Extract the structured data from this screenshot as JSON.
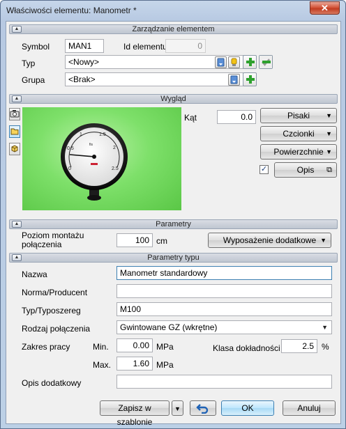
{
  "window": {
    "title": "Właściwości elementu: Manometr *",
    "close_glyph": "✕"
  },
  "sections": {
    "management": "Zarządzanie elementem",
    "appearance": "Wygląd",
    "parameters": "Parametry",
    "type_parameters": "Parametry typu"
  },
  "management": {
    "symbol_label": "Symbol",
    "symbol_value": "MAN1",
    "id_label": "Id elementu",
    "id_value": "0",
    "type_label": "Typ",
    "type_value": "<Nowy>",
    "group_label": "Grupa",
    "group_value": "<Brak>"
  },
  "appearance": {
    "angle_label": "Kąt",
    "angle_value": "0.0",
    "angle_unit": "°",
    "pens_button": "Pisaki",
    "fonts_button": "Czcionki",
    "surfaces_button": "Powierzchnie",
    "description_checked": true,
    "description_button": "Opis"
  },
  "parameters": {
    "mount_level_label": "Poziom montażu połączenia",
    "mount_level_value": "100",
    "mount_level_unit": "cm",
    "extra_equipment_button": "Wyposażenie dodatkowe"
  },
  "type_parameters": {
    "name_label": "Nazwa",
    "name_value": "Manometr standardowy",
    "standard_label": "Norma/Producent",
    "standard_value": "",
    "series_label": "Typ/Typoszereg",
    "series_value": "M100",
    "connection_label": "Rodzaj połączenia",
    "connection_value": "Gwintowane GZ (wkrętne)",
    "range_label": "Zakres pracy",
    "min_label": "Min.",
    "min_value": "0.00",
    "min_unit": "MPa",
    "max_label": "Max.",
    "max_value": "1.60",
    "max_unit": "MPa",
    "accuracy_label": "Klasa dokładności",
    "accuracy_value": "2.5",
    "accuracy_unit": "%",
    "extra_desc_label": "Opis dodatkowy",
    "extra_desc_value": ""
  },
  "footer": {
    "save_template_button": "Zapisz w szablonie",
    "ok_button": "OK",
    "cancel_button": "Anuluj"
  },
  "gauge": {
    "dial_ticks": [
      "0",
      "0.5",
      "1",
      "1.5",
      "2",
      "2.5"
    ],
    "brand": "fis"
  },
  "colors": {
    "preview_bg": "#7ee06a",
    "accent_plus": "#2ea12e",
    "close_red": "#c13c21",
    "default_button": "#3c7fb1"
  }
}
